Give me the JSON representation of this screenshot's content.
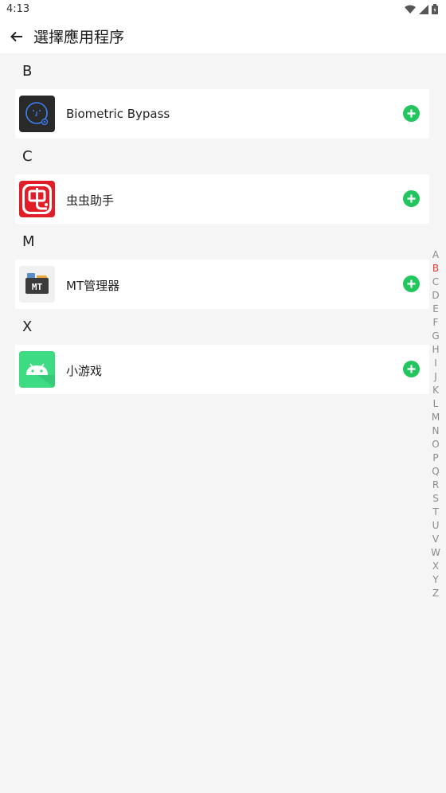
{
  "status": {
    "time": "4:13"
  },
  "app_bar": {
    "title": "選擇應用程序"
  },
  "sections": [
    {
      "letter": "B",
      "apps": [
        {
          "name": "Biometric Bypass",
          "icon": "biometric-icon"
        }
      ]
    },
    {
      "letter": "C",
      "apps": [
        {
          "name": "虫虫助手",
          "icon": "chongchong-icon"
        }
      ]
    },
    {
      "letter": "M",
      "apps": [
        {
          "name": "MT管理器",
          "icon": "mt-manager-icon"
        }
      ]
    },
    {
      "letter": "X",
      "apps": [
        {
          "name": "小游戏",
          "icon": "android-icon"
        }
      ]
    }
  ],
  "alpha_index": [
    "A",
    "B",
    "C",
    "D",
    "E",
    "F",
    "G",
    "H",
    "I",
    "J",
    "K",
    "L",
    "M",
    "N",
    "O",
    "P",
    "Q",
    "R",
    "S",
    "T",
    "U",
    "V",
    "W",
    "X",
    "Y",
    "Z"
  ],
  "alpha_active": "B",
  "colors": {
    "accent_add": "#22c55e",
    "index_active": "#e53935"
  }
}
